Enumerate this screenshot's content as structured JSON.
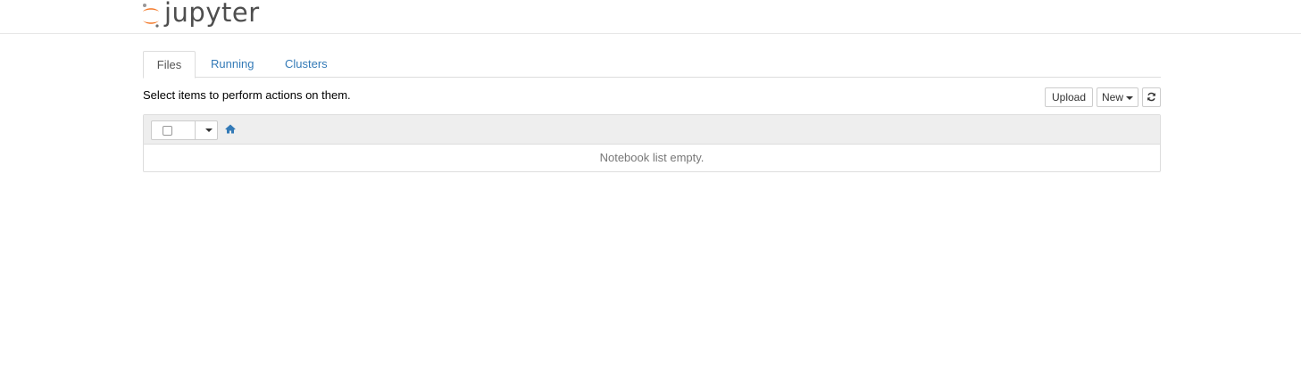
{
  "header": {
    "logo_text": "jupyter"
  },
  "tabs": [
    {
      "label": "Files",
      "active": true
    },
    {
      "label": "Running",
      "active": false
    },
    {
      "label": "Clusters",
      "active": false
    }
  ],
  "toolbar": {
    "hint": "Select items to perform actions on them.",
    "upload_label": "Upload",
    "new_label": "New",
    "refresh_icon": "refresh-icon"
  },
  "notebook_list": {
    "select_all_checked": false,
    "home_icon": "home-icon",
    "empty_message": "Notebook list empty."
  },
  "colors": {
    "link": "#337ab7",
    "jupyter_orange": "#f37726",
    "logo_text": "#4e4e4e",
    "list_header_bg": "#eeeeee",
    "muted_text": "#777777"
  }
}
